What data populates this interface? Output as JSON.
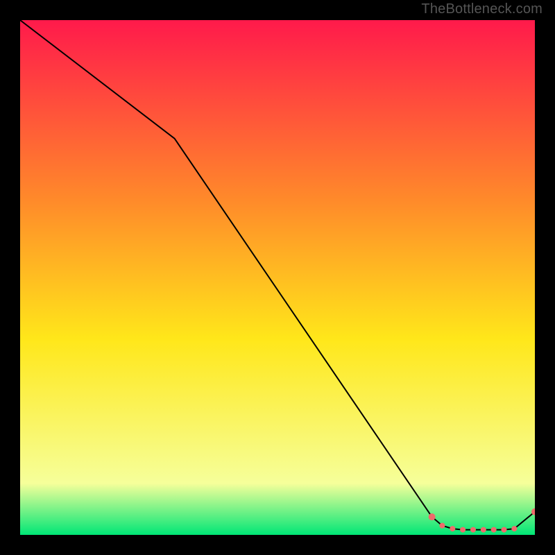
{
  "branding": "TheBottleneck.com",
  "colors": {
    "gradient_top": "#ff1a4b",
    "gradient_upper_mid": "#ff8a2a",
    "gradient_mid": "#ffe71a",
    "gradient_lower_mid": "#f6ff9a",
    "gradient_bottom": "#00e676",
    "line": "#000000",
    "marker": "#ef6b6b",
    "frame_bg": "#000000"
  },
  "chart_data": {
    "type": "line",
    "title": "",
    "xlabel": "",
    "ylabel": "",
    "xlim": [
      0,
      100
    ],
    "ylim": [
      0,
      100
    ],
    "series": [
      {
        "name": "curve",
        "x": [
          0,
          30,
          80,
          82,
          84,
          86,
          88,
          90,
          92,
          94,
          96,
          100
        ],
        "y": [
          100,
          77,
          3.5,
          1.8,
          1.2,
          1.0,
          1.0,
          1.0,
          1.0,
          1.0,
          1.2,
          4.5
        ]
      }
    ],
    "markers": {
      "name": "highlight-points",
      "x": [
        80,
        82,
        84,
        86,
        88,
        90,
        92,
        94,
        96,
        100
      ],
      "y": [
        3.5,
        1.8,
        1.2,
        1.0,
        1.0,
        1.0,
        1.0,
        1.0,
        1.2,
        4.5
      ]
    }
  }
}
